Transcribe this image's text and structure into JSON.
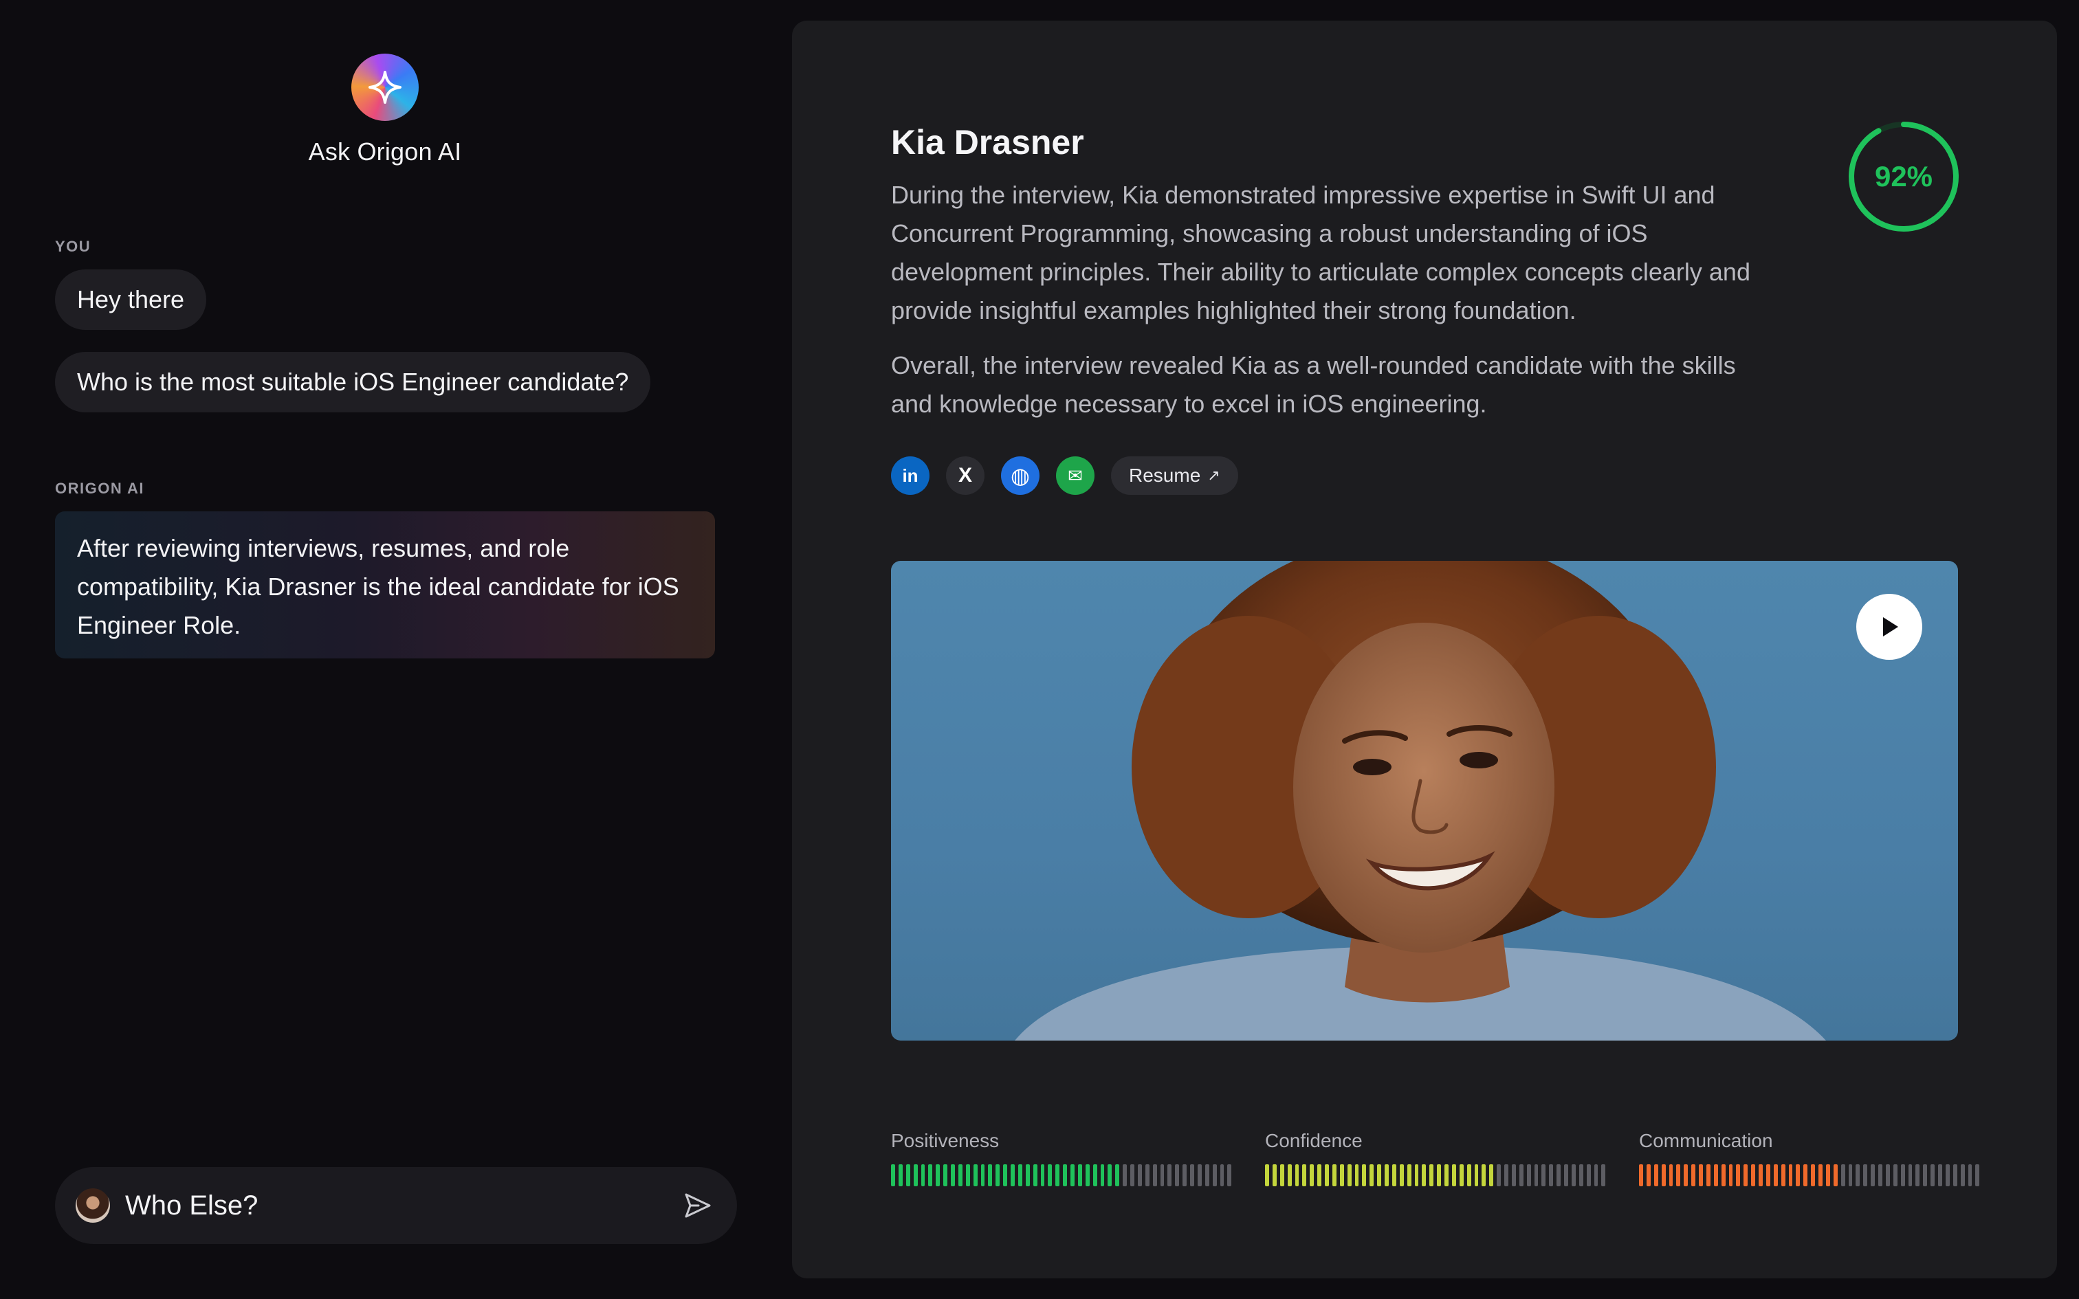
{
  "app": {
    "title": "Ask Origon AI"
  },
  "chat": {
    "you_label": "YOU",
    "user_messages": [
      "Hey there",
      "Who is the most suitable iOS Engineer candidate?"
    ],
    "ai_label": "ORIGON AI",
    "ai_message": "After reviewing interviews, resumes, and role compatibility, Kia Drasner is the ideal candidate for iOS Engineer Role.",
    "composer_value": "Who Else?"
  },
  "candidate": {
    "name": "Kia Drasner",
    "summary": [
      "During the interview, Kia demonstrated impressive expertise in Swift UI and Concurrent Programming, showcasing a robust understanding of iOS development principles. Their ability to articulate complex concepts clearly and provide insightful examples highlighted their strong foundation.",
      "Overall, the interview revealed Kia as a well-rounded candidate with the skills and knowledge necessary to excel in iOS engineering."
    ],
    "score_label": "92%",
    "score_value": 0.92,
    "score_color": "#1fc25b",
    "links": [
      {
        "icon": "linkedin-icon",
        "glyph": "in",
        "color": "#0a66c2"
      },
      {
        "icon": "x-icon",
        "glyph": "X",
        "color": "#2c2c31"
      },
      {
        "icon": "globe-icon",
        "glyph": "◍",
        "color": "#1f6fe0"
      },
      {
        "icon": "mail-icon",
        "glyph": "✉",
        "color": "#1ea54a"
      }
    ],
    "resume_label": "Resume",
    "metrics": [
      {
        "label": "Positiveness",
        "value": 0.68,
        "color": "#1fc25b"
      },
      {
        "label": "Confidence",
        "value": 0.68,
        "color": "#c4d63c"
      },
      {
        "label": "Communication",
        "value": 0.59,
        "color": "#f06a2b"
      }
    ]
  }
}
